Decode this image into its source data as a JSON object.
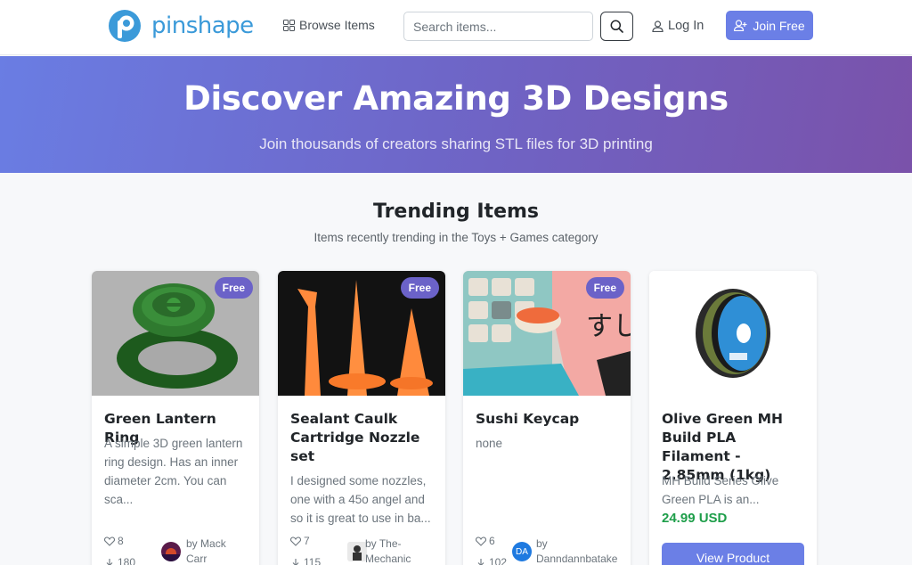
{
  "brand": {
    "name": "pinshape"
  },
  "nav": {
    "browse_label": "Browse Items",
    "search_placeholder": "Search items...",
    "login_label": "Log In",
    "join_label": "Join Free"
  },
  "hero": {
    "title": "Discover Amazing 3D Designs",
    "subtitle": "Join thousands of creators sharing STL files for 3D printing"
  },
  "section": {
    "title": "Trending Items",
    "subtitle": "Items recently trending in the Toys + Games category"
  },
  "colors": {
    "accent": "#6b7fe6",
    "badge": "#6b62c8",
    "price": "#1e9e4a",
    "logo": "#3b9ad9"
  },
  "items": [
    {
      "badge": "Free",
      "title": "Green Lantern Ring",
      "description": "A simple 3D green lantern ring design. Has an inner diameter 2cm. You can sca...",
      "likes": "8",
      "downloads": "180",
      "author_prefix": "by",
      "author": "Mack Carr",
      "image": "green-ring-image"
    },
    {
      "badge": "Free",
      "title": "Sealant Caulk Cartridge Nozzle set",
      "description": "I designed some nozzles, one with a 45o angel and so it is great to use in ba...",
      "likes": "7",
      "downloads": "115",
      "author_prefix": "by",
      "author": "The-Mechanic",
      "image": "orange-nozzles-image"
    },
    {
      "badge": "Free",
      "title": "Sushi Keycap",
      "description": "none",
      "likes": "6",
      "downloads": "102",
      "author_prefix": "by",
      "author": "Danndannbatake",
      "avatar_initials": "DA",
      "image": "sushi-keycap-image"
    },
    {
      "title": "Olive Green MH Build PLA Filament - 2.85mm (1kg)",
      "description": "MH Build Series Olive Green PLA is an...",
      "price": "24.99 USD",
      "button_label": "View Product",
      "image": "filament-spool-image"
    }
  ]
}
